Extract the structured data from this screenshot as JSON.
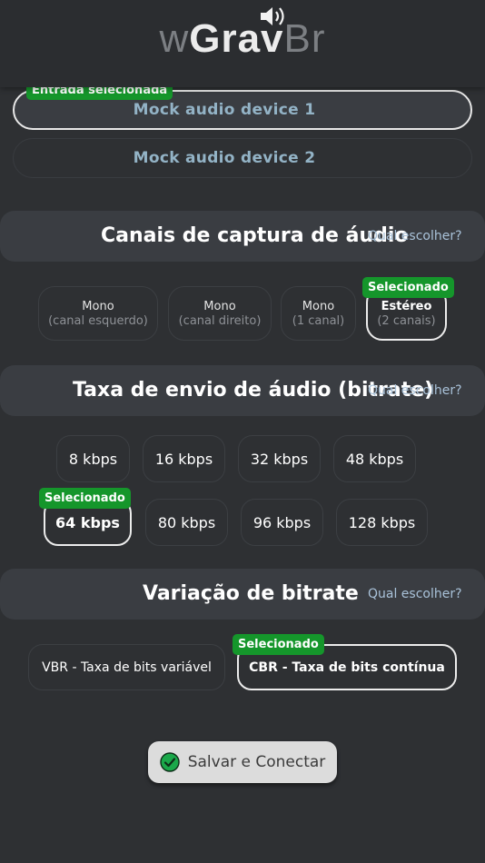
{
  "header": {
    "logo_w": "w",
    "logo_grav": "Grav",
    "logo_br": "Br"
  },
  "devices": {
    "selected_badge": "Entrada selecionada",
    "items": [
      {
        "label": "Mock audio device 1",
        "selected": true
      },
      {
        "label": "Mock audio device 2",
        "selected": false
      }
    ]
  },
  "channels": {
    "title": "Canais de captura de áudio",
    "help": "Qual escolher?",
    "selected_badge": "Selecionado",
    "options": [
      {
        "line1": "Mono",
        "line2": "(canal esquerdo)",
        "selected": false
      },
      {
        "line1": "Mono",
        "line2": "(canal direito)",
        "selected": false
      },
      {
        "line1": "Mono",
        "line2": "(1 canal)",
        "selected": false
      },
      {
        "line1": "Estéreo",
        "line2": "(2 canais)",
        "selected": true
      }
    ]
  },
  "bitrate": {
    "title": "Taxa de envio de áudio (bitrate)",
    "help": "Qual escolher?",
    "selected_badge": "Selecionado",
    "options": [
      {
        "label": "8 kbps",
        "selected": false
      },
      {
        "label": "16 kbps",
        "selected": false
      },
      {
        "label": "32 kbps",
        "selected": false
      },
      {
        "label": "48 kbps",
        "selected": false
      },
      {
        "label": "64 kbps",
        "selected": true
      },
      {
        "label": "80 kbps",
        "selected": false
      },
      {
        "label": "96 kbps",
        "selected": false
      },
      {
        "label": "128 kbps",
        "selected": false
      }
    ]
  },
  "variation": {
    "title": "Variação de bitrate",
    "help": "Qual escolher?",
    "selected_badge": "Selecionado",
    "options": [
      {
        "label": "VBR - Taxa de bits variável",
        "selected": false
      },
      {
        "label": "CBR - Taxa de bits contínua",
        "selected": true
      }
    ]
  },
  "save": {
    "label": "Salvar e Conectar",
    "icon": "check-circle-icon",
    "icon_color": "#1aa84a"
  },
  "colors": {
    "background": "#2e3033",
    "badge": "#15962b",
    "section": "#3a3d42",
    "device_text": "#93b3c6",
    "help_link": "#a9c2d9"
  }
}
